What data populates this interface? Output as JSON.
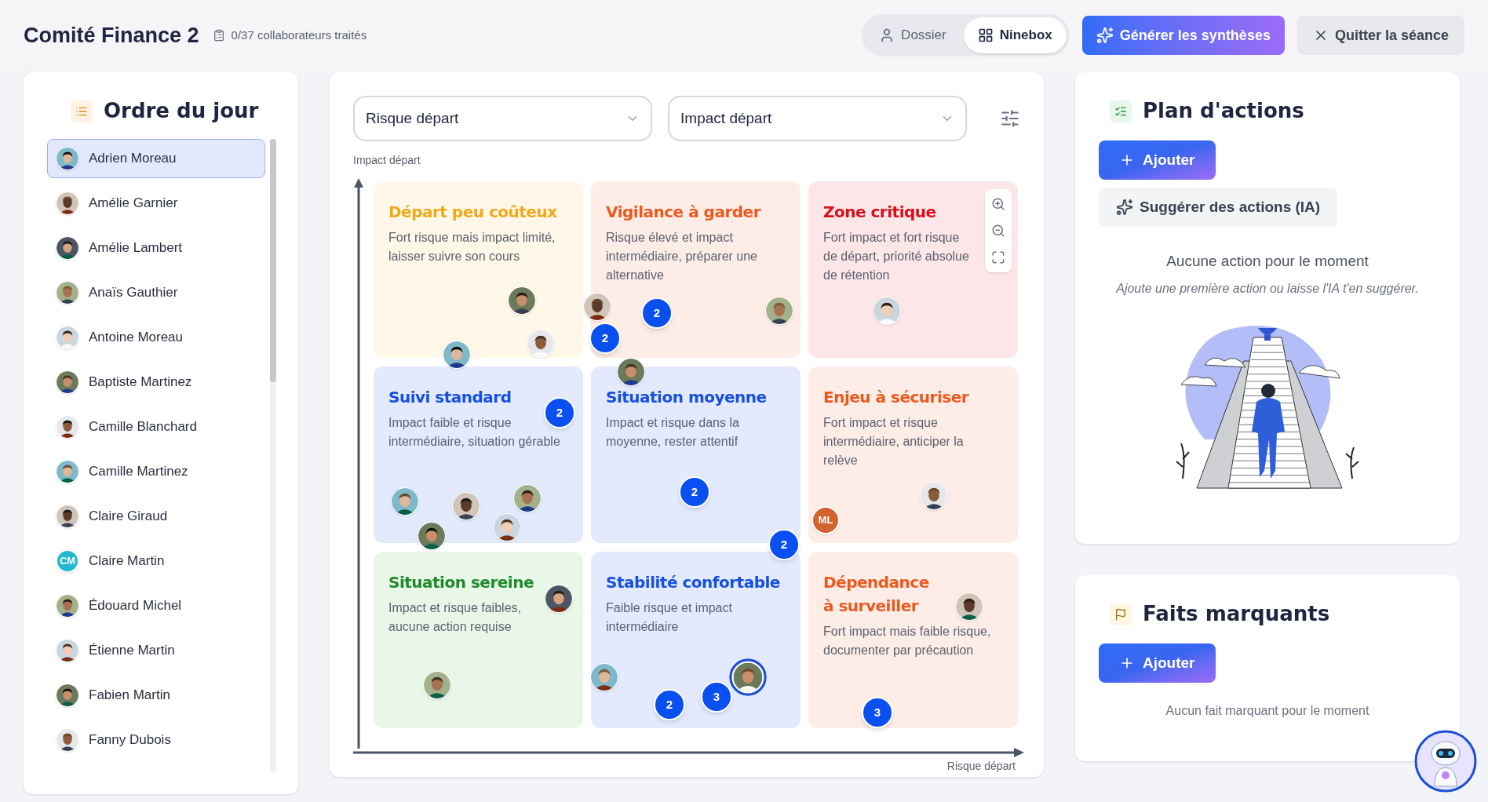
{
  "header": {
    "title": "Comité Finance 2",
    "progress": "0/37 collaborateurs traités",
    "view_toggle": [
      {
        "label": "Dossier",
        "selected": false
      },
      {
        "label": "Ninebox",
        "selected": true
      }
    ],
    "generate_button": "Générer les synthèses",
    "quit_button": "Quitter la séance"
  },
  "agenda": {
    "title": "Ordre du jour",
    "items": [
      {
        "name": "Adrien Moreau",
        "selected": true,
        "avatar": {
          "kind": "photo"
        }
      },
      {
        "name": "Amélie Garnier",
        "selected": false,
        "avatar": {
          "kind": "photo"
        }
      },
      {
        "name": "Amélie Lambert",
        "selected": false,
        "avatar": {
          "kind": "photo"
        }
      },
      {
        "name": "Anaïs Gauthier",
        "selected": false,
        "avatar": {
          "kind": "photo"
        }
      },
      {
        "name": "Antoine Moreau",
        "selected": false,
        "avatar": {
          "kind": "photo"
        }
      },
      {
        "name": "Baptiste Martinez",
        "selected": false,
        "avatar": {
          "kind": "photo"
        }
      },
      {
        "name": "Camille Blanchard",
        "selected": false,
        "avatar": {
          "kind": "photo"
        }
      },
      {
        "name": "Camille Martinez",
        "selected": false,
        "avatar": {
          "kind": "photo"
        }
      },
      {
        "name": "Claire Giraud",
        "selected": false,
        "avatar": {
          "kind": "photo"
        }
      },
      {
        "name": "Claire Martin",
        "selected": false,
        "avatar": {
          "kind": "initials",
          "text": "CM",
          "color": "#22b8cf"
        }
      },
      {
        "name": "Édouard Michel",
        "selected": false,
        "avatar": {
          "kind": "photo"
        }
      },
      {
        "name": "Étienne Martin",
        "selected": false,
        "avatar": {
          "kind": "photo"
        }
      },
      {
        "name": "Fabien Martin",
        "selected": false,
        "avatar": {
          "kind": "photo"
        }
      },
      {
        "name": "Fanny Dubois",
        "selected": false,
        "avatar": {
          "kind": "photo"
        }
      }
    ]
  },
  "ninebox": {
    "selects": [
      {
        "value": "Risque départ"
      },
      {
        "value": "Impact départ"
      }
    ],
    "y_axis_label": "Impact départ",
    "x_axis_label": "Risque départ",
    "cells": [
      {
        "kind": "yellow",
        "title": "Départ peu coûteux",
        "description": "Fort risque mais impact limité, laisser suivre son cours",
        "markers": [
          {
            "kind": "avatar",
            "highlighted": false
          },
          {
            "kind": "avatar",
            "highlighted": false
          },
          {
            "kind": "avatar",
            "highlighted": false
          }
        ]
      },
      {
        "kind": "orange",
        "title": "Vigilance à garder",
        "description": "Risque élevé et impact intermédiaire, préparer une alternative",
        "markers": [
          {
            "kind": "avatar",
            "highlighted": false
          },
          {
            "kind": "cluster",
            "count": "2"
          },
          {
            "kind": "avatar",
            "highlighted": false
          },
          {
            "kind": "cluster",
            "count": "2"
          },
          {
            "kind": "avatar",
            "highlighted": false
          }
        ]
      },
      {
        "kind": "red",
        "title": "Zone critique",
        "description": "Fort impact et fort risque de départ, priorité absolue de rétention",
        "markers": [
          {
            "kind": "avatar",
            "highlighted": false
          }
        ]
      },
      {
        "kind": "blue",
        "title": "Suivi standard",
        "description": "Impact faible et risque intermédiaire, situation gérable",
        "markers": [
          {
            "kind": "avatar",
            "highlighted": false
          },
          {
            "kind": "avatar",
            "highlighted": false
          },
          {
            "kind": "cluster",
            "count": "2"
          },
          {
            "kind": "avatar",
            "highlighted": false
          },
          {
            "kind": "avatar",
            "highlighted": false
          },
          {
            "kind": "avatar",
            "highlighted": false
          }
        ]
      },
      {
        "kind": "blue",
        "title": "Situation moyenne",
        "description": "Impact et risque dans la moyenne, rester attentif",
        "markers": [
          {
            "kind": "cluster",
            "count": "2"
          },
          {
            "kind": "cluster",
            "count": "2"
          }
        ]
      },
      {
        "kind": "orange",
        "title": "Enjeu à sécuriser",
        "description": "Fort impact et risque intermédiaire, anticiper la relève",
        "markers": [
          {
            "kind": "avatar",
            "highlighted": false
          },
          {
            "kind": "initials",
            "text": "ML",
            "color": "#d2632f"
          }
        ]
      },
      {
        "kind": "green",
        "title": "Situation sereine",
        "description": "Impact et risque faibles, aucune action requise",
        "markers": [
          {
            "kind": "avatar",
            "highlighted": false
          },
          {
            "kind": "avatar",
            "highlighted": false
          }
        ]
      },
      {
        "kind": "blue",
        "title": "Stabilité confortable",
        "description": "Faible risque et impact intermédiaire",
        "markers": [
          {
            "kind": "avatar",
            "highlighted": true
          },
          {
            "kind": "cluster",
            "count": "3"
          },
          {
            "kind": "avatar",
            "highlighted": false
          },
          {
            "kind": "cluster",
            "count": "2"
          }
        ]
      },
      {
        "kind": "orange",
        "title": "Dépendance à surveiller",
        "description": "Fort impact mais faible risque, documenter par précaution",
        "markers": [
          {
            "kind": "avatar",
            "highlighted": false
          },
          {
            "kind": "cluster",
            "count": "3"
          }
        ]
      }
    ]
  },
  "actions": {
    "title": "Plan d'actions",
    "add_button": "Ajouter",
    "suggest_button": "Suggérer des actions (IA)",
    "empty_title": "Aucune action pour le moment",
    "empty_hint": "Ajoute une première action ou laisse l'IA t'en suggérer."
  },
  "highlights": {
    "title": "Faits marquants",
    "add_button": "Ajouter",
    "empty_text": "Aucun fait marquant pour le moment"
  }
}
